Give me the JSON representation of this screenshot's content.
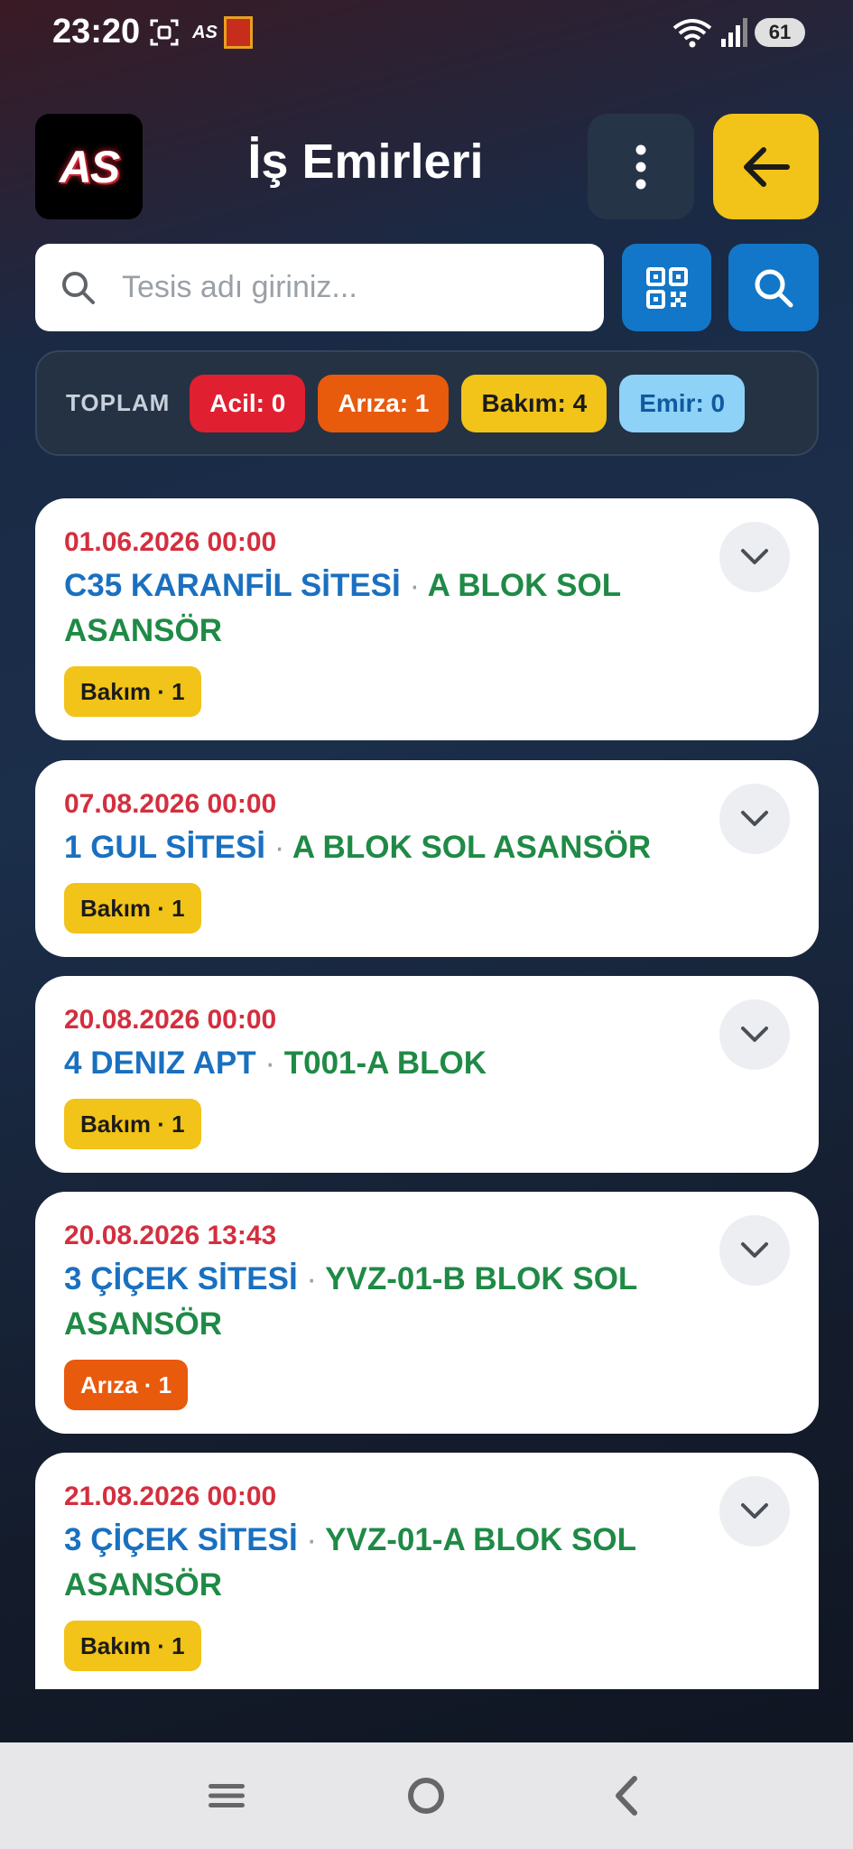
{
  "status_bar": {
    "time": "23:20",
    "as_label": "AS",
    "battery": "61"
  },
  "header": {
    "logo_text": "AS",
    "title": "İş Emirleri"
  },
  "search": {
    "placeholder": "Tesis adı giriniz..."
  },
  "summary": {
    "label": "TOPLAM",
    "acil": "Acil: 0",
    "ariza": "Arıza: 1",
    "bakim": "Bakım: 4",
    "emir": "Emir: 0"
  },
  "orders": [
    {
      "date": "01.06.2026 00:00",
      "site": "C35 KARANFİL SİTESİ",
      "separator": "·",
      "elevator": "A BLOK SOL ASANSÖR",
      "tag": "Bakım · 1",
      "tag_type": "bakim"
    },
    {
      "date": "07.08.2026 00:00",
      "site": "1 GUL SİTESİ",
      "separator": "·",
      "elevator": "A BLOK SOL ASANSÖR",
      "tag": "Bakım · 1",
      "tag_type": "bakim"
    },
    {
      "date": "20.08.2026 00:00",
      "site": "4 DENIZ APT",
      "separator": "·",
      "elevator": "T001-A BLOK",
      "tag": "Bakım · 1",
      "tag_type": "bakim"
    },
    {
      "date": "20.08.2026 13:43",
      "site": "3 ÇİÇEK SİTESİ",
      "separator": "·",
      "elevator": "YVZ-01-B BLOK SOL ASANSÖR",
      "tag": "Arıza · 1",
      "tag_type": "ariza"
    },
    {
      "date": "21.08.2026 00:00",
      "site": "3 ÇİÇEK SİTESİ",
      "separator": "·",
      "elevator": "YVZ-01-A BLOK SOL ASANSÖR",
      "tag": "Bakım · 1",
      "tag_type": "bakim"
    }
  ],
  "colors": {
    "accent_yellow": "#f2c318",
    "accent_blue": "#1277c8",
    "acil_red": "#e02030",
    "ariza_orange": "#e85a0c",
    "emir_light_blue": "#8ed2f8",
    "date_red": "#d32f3f",
    "site_blue": "#1a70c0",
    "elevator_green": "#1f8a46"
  },
  "icons": {
    "menu": "more-vertical-icon",
    "back": "arrow-left-icon",
    "search": "search-icon",
    "qr": "qr-code-icon",
    "expand": "chevron-down-icon",
    "nav_recents": "recents-icon",
    "nav_home": "home-icon",
    "nav_back": "back-icon"
  }
}
